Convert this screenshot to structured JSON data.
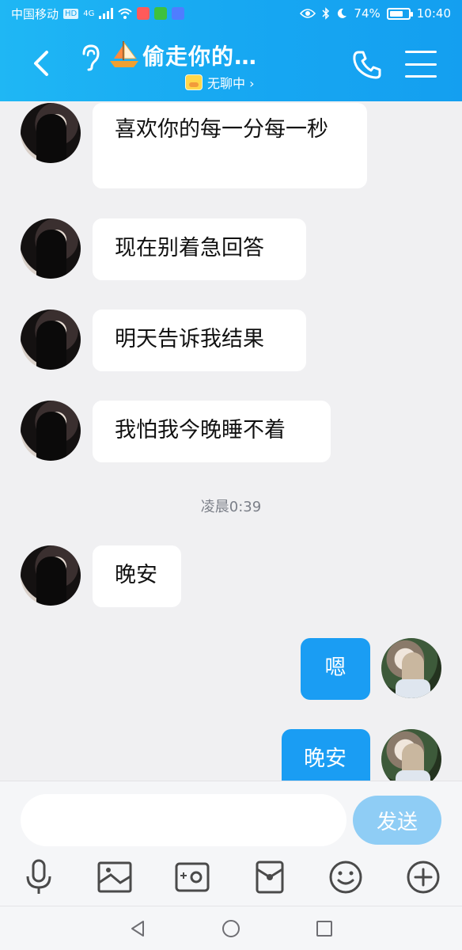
{
  "status_bar": {
    "carrier": "中国移动",
    "hd_badge": "HD",
    "network": "4G",
    "battery_text": "74%",
    "battery_level": 0.74,
    "time": "10:40",
    "icons": [
      "signal-icon",
      "wifi-icon",
      "app-notification-icon",
      "eye-icon",
      "bluetooth-icon",
      "moon-icon",
      "battery-icon"
    ]
  },
  "header": {
    "title": "偷走你的…",
    "status": "无聊中 ›",
    "back_icon": "chevron-left-icon",
    "phone_icon": "phone-icon",
    "menu_icon": "menu-icon"
  },
  "messages": [
    {
      "side": "in",
      "text": "喜欢你的每一分每一秒"
    },
    {
      "side": "in",
      "text": "现在别着急回答"
    },
    {
      "side": "in",
      "text": "明天告诉我结果"
    },
    {
      "side": "in",
      "text": "我怕我今晚睡不着"
    },
    {
      "side": "time",
      "text": "凌晨0:39"
    },
    {
      "side": "in",
      "text": "晚安"
    },
    {
      "side": "out",
      "text": "嗯"
    },
    {
      "side": "out",
      "text": "晚安"
    }
  ],
  "input": {
    "placeholder": "",
    "value": "",
    "send_label": "发送"
  },
  "toolbar": [
    "microphone-icon",
    "image-icon",
    "camera-icon",
    "red-packet-icon",
    "emoji-icon",
    "plus-icon"
  ],
  "navbar": [
    "nav-back-icon",
    "nav-home-icon",
    "nav-recents-icon"
  ],
  "colors": {
    "header_blue": "#17a8f2",
    "bubble_out": "#1a9df3",
    "send_button": "#8fcdf5"
  }
}
